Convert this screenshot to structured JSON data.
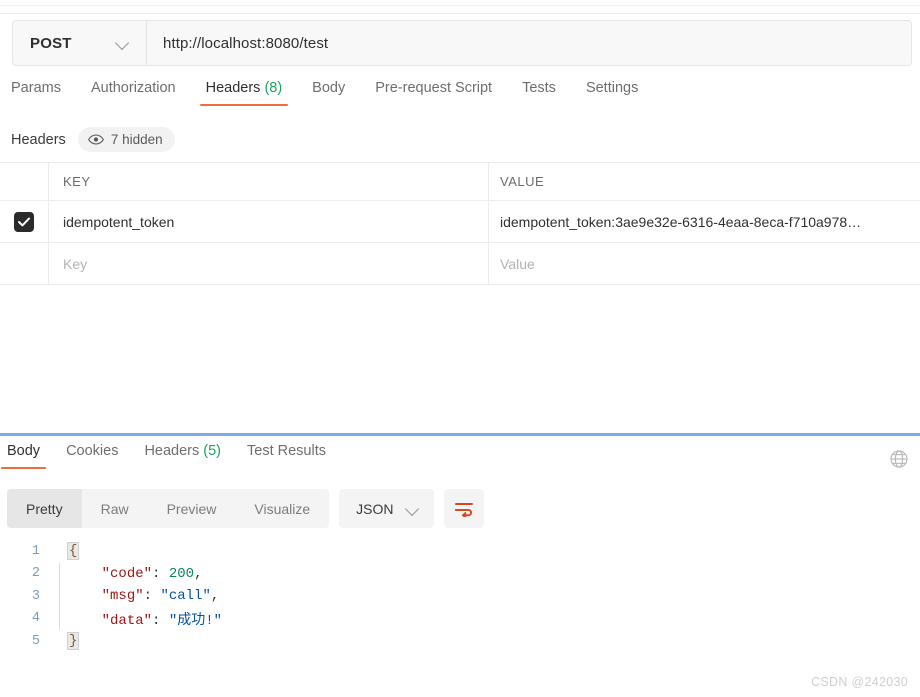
{
  "request": {
    "method": "POST",
    "method_icon": "chevron-down-icon",
    "url": "http://localhost:8080/test",
    "tabs": [
      {
        "label": "Params",
        "active": false
      },
      {
        "label": "Authorization",
        "active": false
      },
      {
        "label": "Headers",
        "count": "(8)",
        "active": true
      },
      {
        "label": "Body",
        "active": false
      },
      {
        "label": "Pre-request Script",
        "active": false
      },
      {
        "label": "Tests",
        "active": false
      },
      {
        "label": "Settings",
        "active": false
      }
    ],
    "headers_section": {
      "title": "Headers",
      "hidden_badge": "7 hidden",
      "hidden_icon": "eye-icon"
    },
    "table": {
      "columns": [
        "KEY",
        "VALUE"
      ],
      "rows": [
        {
          "checked": true,
          "key": "idempotent_token",
          "value": "idempotent_token:3ae9e32e-6316-4eaa-8eca-f710a978…"
        }
      ],
      "placeholder_row": {
        "key": "Key",
        "value": "Value"
      }
    }
  },
  "response": {
    "tabs": [
      {
        "label": "Body",
        "active": true
      },
      {
        "label": "Cookies",
        "active": false
      },
      {
        "label": "Headers",
        "count": "(5)",
        "active": false
      },
      {
        "label": "Test Results",
        "active": false
      }
    ],
    "globe_icon": "globe-icon",
    "format_bar": {
      "views": [
        {
          "label": "Pretty",
          "active": true
        },
        {
          "label": "Raw",
          "active": false
        },
        {
          "label": "Preview",
          "active": false
        },
        {
          "label": "Visualize",
          "active": false
        }
      ],
      "language": "JSON",
      "language_icon": "chevron-down-icon",
      "wrap_icon": "word-wrap-icon"
    },
    "body": {
      "lines": [
        {
          "no": "1",
          "tokens": [
            {
              "t": "{",
              "c": "brace-hl"
            }
          ]
        },
        {
          "no": "2",
          "tokens": [
            {
              "t": "    ",
              "c": "k-pun"
            },
            {
              "t": "\"code\"",
              "c": "k-key"
            },
            {
              "t": ": ",
              "c": "k-pun"
            },
            {
              "t": "200",
              "c": "k-num"
            },
            {
              "t": ",",
              "c": "k-pun"
            }
          ]
        },
        {
          "no": "3",
          "tokens": [
            {
              "t": "    ",
              "c": "k-pun"
            },
            {
              "t": "\"msg\"",
              "c": "k-key"
            },
            {
              "t": ": ",
              "c": "k-pun"
            },
            {
              "t": "\"call\"",
              "c": "k-str"
            },
            {
              "t": ",",
              "c": "k-pun"
            }
          ]
        },
        {
          "no": "4",
          "tokens": [
            {
              "t": "    ",
              "c": "k-pun"
            },
            {
              "t": "\"data\"",
              "c": "k-key"
            },
            {
              "t": ": ",
              "c": "k-pun"
            },
            {
              "t": "\"成功!\"",
              "c": "k-str"
            }
          ]
        },
        {
          "no": "5",
          "tokens": [
            {
              "t": "}",
              "c": "brace-hl"
            }
          ]
        }
      ]
    }
  },
  "watermark": "CSDN @242030",
  "colors": {
    "accent": "#f26b3a",
    "count_green": "#1aa260",
    "divider_blue": "#7fabe3",
    "json_key": "#a31515",
    "json_string": "#0451a5",
    "json_number": "#098658"
  }
}
